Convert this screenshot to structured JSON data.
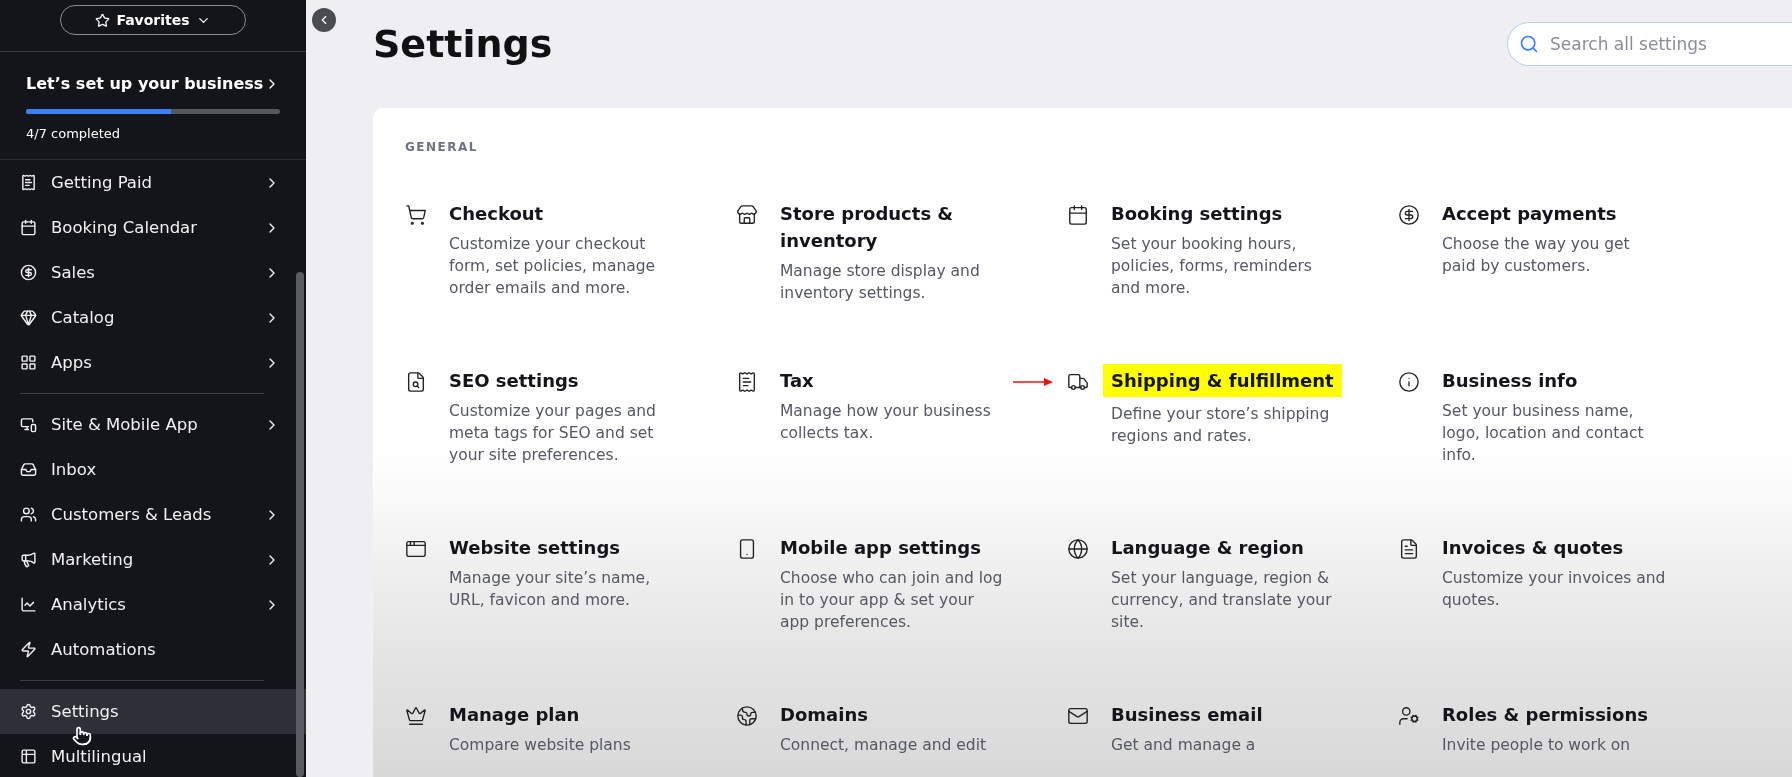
{
  "sidebar": {
    "favorites": {
      "label": "Favorites"
    },
    "setup": {
      "title": "Let’s set up your business",
      "level": 0.57,
      "progress": "4/7 completed"
    },
    "groups": [
      {
        "items": [
          {
            "label": "Getting Paid",
            "chevron": true,
            "selected": false
          },
          {
            "label": "Booking Calendar",
            "chevron": true,
            "selected": false
          },
          {
            "label": "Sales",
            "chevron": true,
            "selected": false
          },
          {
            "label": "Catalog",
            "chevron": true,
            "selected": false
          },
          {
            "label": "Apps",
            "chevron": true,
            "selected": false
          }
        ]
      },
      {
        "items": [
          {
            "label": "Site & Mobile App",
            "chevron": true,
            "selected": false
          },
          {
            "label": "Inbox",
            "chevron": false,
            "selected": false
          },
          {
            "label": "Customers & Leads",
            "chevron": true,
            "selected": false
          },
          {
            "label": "Marketing",
            "chevron": true,
            "selected": false
          },
          {
            "label": "Analytics",
            "chevron": true,
            "selected": false
          },
          {
            "label": "Automations",
            "chevron": false,
            "selected": false
          }
        ]
      },
      {
        "items": [
          {
            "label": "Settings",
            "chevron": false,
            "selected": true
          },
          {
            "label": "Multilingual",
            "chevron": false,
            "selected": false
          }
        ]
      }
    ]
  },
  "page": {
    "title": "Settings",
    "search": {
      "placeholder": "Search all settings"
    }
  },
  "section": {
    "heading": "GENERAL",
    "items": [
      {
        "title": "Checkout",
        "description": "Customize your checkout form, set policies, manage order emails and more.",
        "highlighted": false
      },
      {
        "title": "Store products & inventory",
        "description": "Manage store display and inventory settings.",
        "highlighted": false
      },
      {
        "title": "Booking settings",
        "description": "Set your booking hours, policies, forms, reminders and more.",
        "highlighted": false
      },
      {
        "title": "Accept payments",
        "description": "Choose the way you get paid by customers.",
        "highlighted": false
      },
      {
        "title": "SEO settings",
        "description": "Customize your pages and meta tags for SEO and set your site preferences.",
        "highlighted": false
      },
      {
        "title": "Tax",
        "description": "Manage how your business collects tax.",
        "highlighted": false
      },
      {
        "title": "Shipping & fulfillment",
        "description": "Define your store’s shipping regions and rates.",
        "highlighted": true
      },
      {
        "title": "Business info",
        "description": "Set your business name, logo, location and contact info.",
        "highlighted": false
      },
      {
        "title": "Website settings",
        "description": "Manage your site’s name, URL, favicon and more.",
        "highlighted": false
      },
      {
        "title": "Mobile app settings",
        "description": "Choose who can join and log in to your app & set your app preferences.",
        "highlighted": false
      },
      {
        "title": "Language & region",
        "description": "Set your language, region & currency, and translate your site.",
        "highlighted": false
      },
      {
        "title": "Invoices & quotes",
        "description": "Customize your invoices and quotes.",
        "highlighted": false
      },
      {
        "title": "Manage plan",
        "description": "Compare website plans",
        "highlighted": false
      },
      {
        "title": "Domains",
        "description": "Connect, manage and edit",
        "highlighted": false
      },
      {
        "title": "Business email",
        "description": "Get and manage a",
        "highlighted": false
      },
      {
        "title": "Roles & permissions",
        "description": "Invite people to work on",
        "highlighted": false
      }
    ]
  }
}
